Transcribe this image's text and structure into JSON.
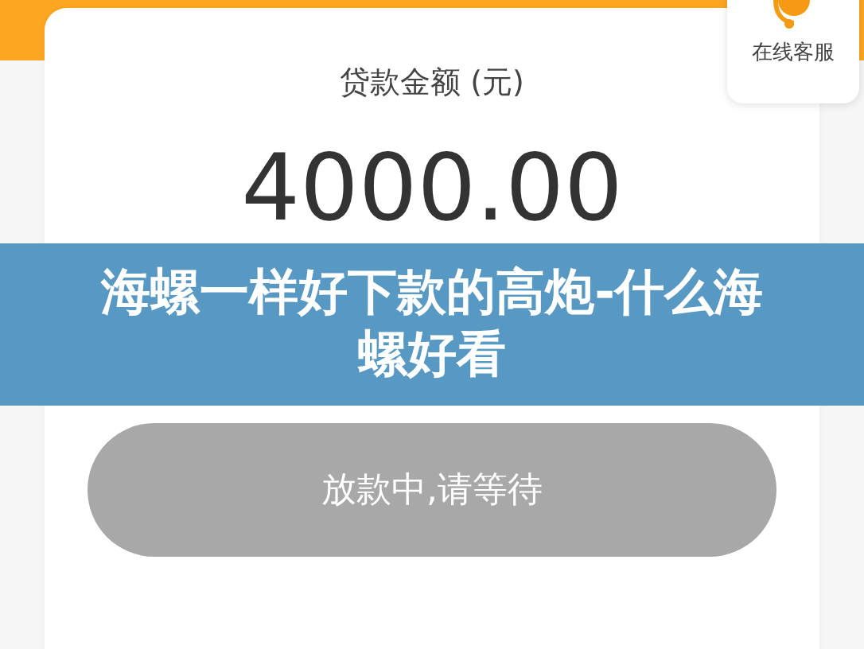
{
  "loan": {
    "label": "贷款金额 (元)",
    "amount": "4000.00"
  },
  "action_button": {
    "label": "放款中,请等待",
    "disabled": true
  },
  "support_widget": {
    "label": "在线客服"
  },
  "overlay_title": {
    "text": "海螺一样好下款的高炮-什么海螺好看"
  }
}
